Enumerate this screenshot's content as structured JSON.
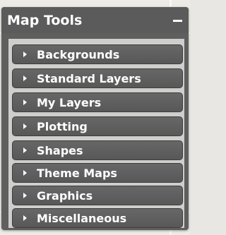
{
  "panel": {
    "title": "Map Tools",
    "collapse_icon": "minus-icon"
  },
  "menu": {
    "items": [
      {
        "label": "Backgrounds",
        "icon": "triangle-right-icon"
      },
      {
        "label": "Standard Layers",
        "icon": "triangle-right-icon"
      },
      {
        "label": "My Layers",
        "icon": "triangle-right-icon"
      },
      {
        "label": "Plotting",
        "icon": "triangle-right-icon"
      },
      {
        "label": "Shapes",
        "icon": "triangle-right-icon"
      },
      {
        "label": "Theme Maps",
        "icon": "triangle-right-icon"
      },
      {
        "label": "Graphics",
        "icon": "triangle-right-icon"
      },
      {
        "label": "Miscellaneous",
        "icon": "triangle-right-icon"
      }
    ]
  },
  "colors": {
    "header": "#5b5b5b",
    "button": "#606060",
    "text": "#ffffff"
  }
}
